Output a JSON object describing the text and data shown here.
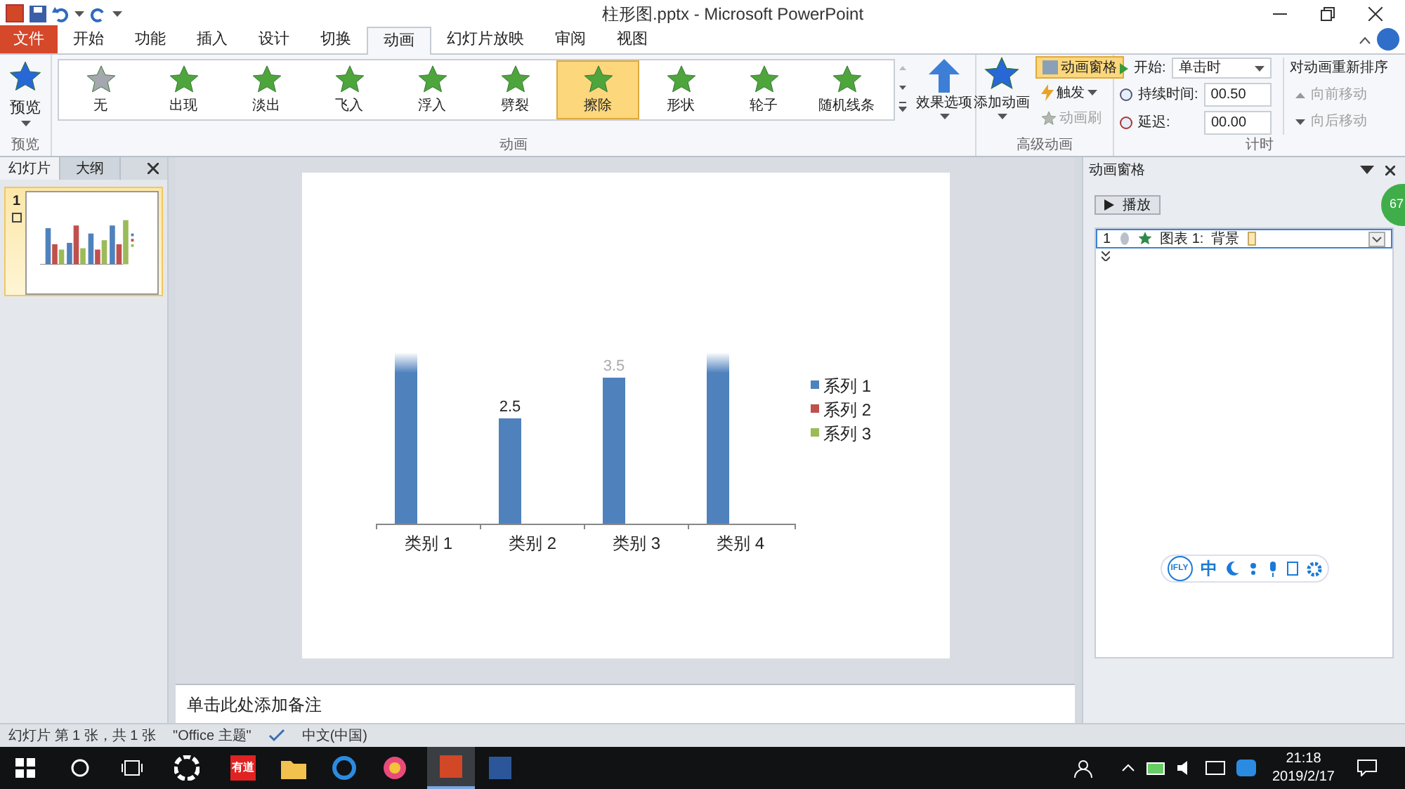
{
  "title_bar": {
    "title": "柱形图.pptx - Microsoft PowerPoint"
  },
  "tabs": [
    {
      "label": "文件",
      "kind": "file",
      "selected": false
    },
    {
      "label": "开始",
      "kind": "tab",
      "selected": false
    },
    {
      "label": "功能",
      "kind": "tab",
      "selected": false
    },
    {
      "label": "插入",
      "kind": "tab",
      "selected": false
    },
    {
      "label": "设计",
      "kind": "tab",
      "selected": false
    },
    {
      "label": "切换",
      "kind": "tab",
      "selected": false
    },
    {
      "label": "动画",
      "kind": "tab",
      "selected": true
    },
    {
      "label": "幻灯片放映",
      "kind": "tab",
      "selected": false
    },
    {
      "label": "审阅",
      "kind": "tab",
      "selected": false
    },
    {
      "label": "视图",
      "kind": "tab",
      "selected": false
    }
  ],
  "ribbon": {
    "preview": {
      "button": "预览",
      "group": "预览"
    },
    "animations": {
      "items": [
        {
          "label": "无",
          "kind": "none",
          "selected": false
        },
        {
          "label": "出现",
          "kind": "effect",
          "selected": false
        },
        {
          "label": "淡出",
          "kind": "effect",
          "selected": false
        },
        {
          "label": "飞入",
          "kind": "effect",
          "selected": false
        },
        {
          "label": "浮入",
          "kind": "effect",
          "selected": false
        },
        {
          "label": "劈裂",
          "kind": "effect",
          "selected": false
        },
        {
          "label": "擦除",
          "kind": "effect",
          "selected": true
        },
        {
          "label": "形状",
          "kind": "effect",
          "selected": false
        },
        {
          "label": "轮子",
          "kind": "effect",
          "selected": false
        },
        {
          "label": "随机线条",
          "kind": "effect",
          "selected": false
        }
      ],
      "effect_options": "效果选项",
      "group": "动画"
    },
    "advanced": {
      "add": "添加动画",
      "pane": {
        "label": "动画窗格",
        "on": true
      },
      "trigger": "触发",
      "painter": {
        "label": "动画刷",
        "disabled": true
      },
      "group": "高级动画"
    },
    "timing": {
      "start_label": "开始:",
      "start_value": "单击时",
      "duration_label": "持续时间:",
      "duration_value": "00.50",
      "delay_label": "延迟:",
      "delay_value": "00.00",
      "reorder_title": "对动画重新排序",
      "move_earlier": {
        "label": "向前移动",
        "disabled": true
      },
      "move_later": {
        "label": "向后移动",
        "disabled": true
      },
      "group": "计时"
    }
  },
  "slides_panel": {
    "tabs": [
      {
        "label": "幻灯片",
        "selected": true
      },
      {
        "label": "大纲",
        "selected": false
      }
    ],
    "slides": [
      {
        "number": "1",
        "selected": true
      }
    ]
  },
  "slide": {
    "chart": {
      "data_labels": [
        {
          "text": "2.5"
        },
        {
          "text": "3.5"
        }
      ],
      "categories": [
        "类别 1",
        "类别 2",
        "类别 3",
        "类别 4"
      ],
      "legend": [
        {
          "name": "系列 1",
          "color": "#4f81bd"
        },
        {
          "name": "系列 2",
          "color": "#c0504d"
        },
        {
          "name": "系列 3",
          "color": "#9bbb59"
        }
      ]
    }
  },
  "notes": {
    "placeholder": "单击此处添加备注"
  },
  "animation_pane": {
    "title": "动画窗格",
    "play": "播放",
    "items": [
      {
        "index": "1",
        "label": "图表 1:  背景",
        "selected": true
      }
    ],
    "badge": "67",
    "ifly": {
      "logo": "IFLY",
      "mode": "中"
    }
  },
  "status_bar": {
    "slide": "幻灯片 第 1 张，共 1 张",
    "theme": "\"Office 主题\"",
    "language": "中文(中国)"
  },
  "taskbar": {
    "app": "有道",
    "time": "21:18",
    "date": "2019/2/17"
  }
}
